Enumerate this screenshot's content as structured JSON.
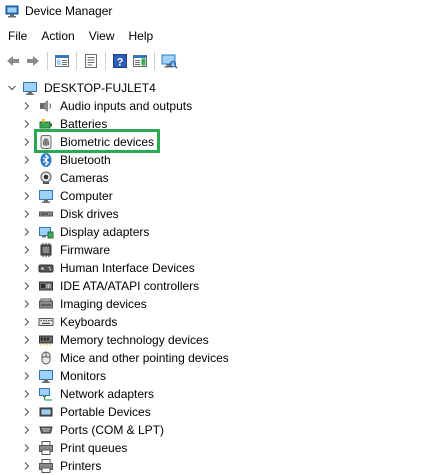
{
  "window": {
    "title": "Device Manager",
    "icon": "device-manager-icon"
  },
  "menu": {
    "items": [
      "File",
      "Action",
      "View",
      "Help"
    ]
  },
  "toolbar": {
    "buttons": [
      "back-arrow-icon",
      "forward-arrow-icon",
      "show-hide-tree-icon",
      "properties-icon",
      "help-icon",
      "action-pane-icon",
      "scan-hardware-icon"
    ]
  },
  "tree": {
    "root": {
      "label": "DESKTOP-FUJLET4",
      "icon": "computer-icon",
      "expanded": true
    },
    "items": [
      {
        "label": "Audio inputs and outputs",
        "icon": "speaker-icon"
      },
      {
        "label": "Batteries",
        "icon": "battery-icon"
      },
      {
        "label": "Biometric devices",
        "icon": "fingerprint-icon",
        "highlighted": true
      },
      {
        "label": "Bluetooth",
        "icon": "bluetooth-icon"
      },
      {
        "label": "Cameras",
        "icon": "camera-icon"
      },
      {
        "label": "Computer",
        "icon": "monitor-icon"
      },
      {
        "label": "Disk drives",
        "icon": "disk-drive-icon"
      },
      {
        "label": "Display adapters",
        "icon": "display-adapter-icon"
      },
      {
        "label": "Firmware",
        "icon": "firmware-icon"
      },
      {
        "label": "Human Interface Devices",
        "icon": "hid-icon"
      },
      {
        "label": "IDE ATA/ATAPI controllers",
        "icon": "ide-controller-icon"
      },
      {
        "label": "Imaging devices",
        "icon": "imaging-icon"
      },
      {
        "label": "Keyboards",
        "icon": "keyboard-icon"
      },
      {
        "label": "Memory technology devices",
        "icon": "memory-icon"
      },
      {
        "label": "Mice and other pointing devices",
        "icon": "mouse-icon"
      },
      {
        "label": "Monitors",
        "icon": "monitor-icon"
      },
      {
        "label": "Network adapters",
        "icon": "network-icon"
      },
      {
        "label": "Portable Devices",
        "icon": "portable-device-icon"
      },
      {
        "label": "Ports (COM & LPT)",
        "icon": "ports-icon"
      },
      {
        "label": "Print queues",
        "icon": "printer-icon"
      },
      {
        "label": "Printers",
        "icon": "printer-icon"
      }
    ]
  },
  "colors": {
    "highlight_border": "#2aa852",
    "selection_fill": "#cce8ff",
    "icon_blue": "#2b78c5",
    "icon_gray": "#6b6b6b",
    "chevron": "#5a5a5a"
  }
}
